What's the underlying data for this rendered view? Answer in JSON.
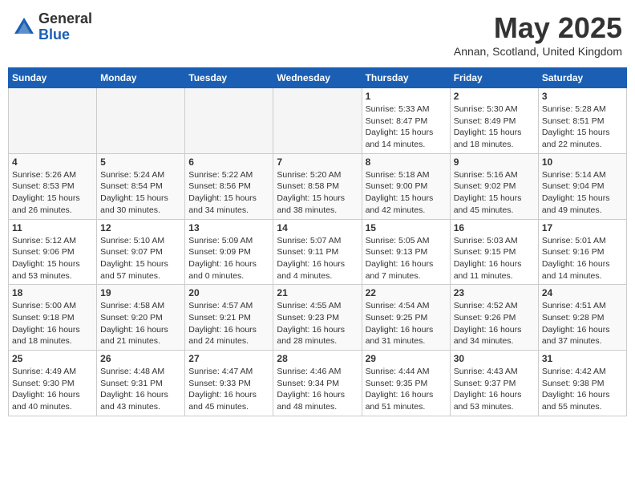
{
  "header": {
    "logo_general": "General",
    "logo_blue": "Blue",
    "month_title": "May 2025",
    "location": "Annan, Scotland, United Kingdom"
  },
  "weekdays": [
    "Sunday",
    "Monday",
    "Tuesday",
    "Wednesday",
    "Thursday",
    "Friday",
    "Saturday"
  ],
  "weeks": [
    [
      {
        "day": "",
        "info": ""
      },
      {
        "day": "",
        "info": ""
      },
      {
        "day": "",
        "info": ""
      },
      {
        "day": "",
        "info": ""
      },
      {
        "day": "1",
        "info": "Sunrise: 5:33 AM\nSunset: 8:47 PM\nDaylight: 15 hours\nand 14 minutes."
      },
      {
        "day": "2",
        "info": "Sunrise: 5:30 AM\nSunset: 8:49 PM\nDaylight: 15 hours\nand 18 minutes."
      },
      {
        "day": "3",
        "info": "Sunrise: 5:28 AM\nSunset: 8:51 PM\nDaylight: 15 hours\nand 22 minutes."
      }
    ],
    [
      {
        "day": "4",
        "info": "Sunrise: 5:26 AM\nSunset: 8:53 PM\nDaylight: 15 hours\nand 26 minutes."
      },
      {
        "day": "5",
        "info": "Sunrise: 5:24 AM\nSunset: 8:54 PM\nDaylight: 15 hours\nand 30 minutes."
      },
      {
        "day": "6",
        "info": "Sunrise: 5:22 AM\nSunset: 8:56 PM\nDaylight: 15 hours\nand 34 minutes."
      },
      {
        "day": "7",
        "info": "Sunrise: 5:20 AM\nSunset: 8:58 PM\nDaylight: 15 hours\nand 38 minutes."
      },
      {
        "day": "8",
        "info": "Sunrise: 5:18 AM\nSunset: 9:00 PM\nDaylight: 15 hours\nand 42 minutes."
      },
      {
        "day": "9",
        "info": "Sunrise: 5:16 AM\nSunset: 9:02 PM\nDaylight: 15 hours\nand 45 minutes."
      },
      {
        "day": "10",
        "info": "Sunrise: 5:14 AM\nSunset: 9:04 PM\nDaylight: 15 hours\nand 49 minutes."
      }
    ],
    [
      {
        "day": "11",
        "info": "Sunrise: 5:12 AM\nSunset: 9:06 PM\nDaylight: 15 hours\nand 53 minutes."
      },
      {
        "day": "12",
        "info": "Sunrise: 5:10 AM\nSunset: 9:07 PM\nDaylight: 15 hours\nand 57 minutes."
      },
      {
        "day": "13",
        "info": "Sunrise: 5:09 AM\nSunset: 9:09 PM\nDaylight: 16 hours\nand 0 minutes."
      },
      {
        "day": "14",
        "info": "Sunrise: 5:07 AM\nSunset: 9:11 PM\nDaylight: 16 hours\nand 4 minutes."
      },
      {
        "day": "15",
        "info": "Sunrise: 5:05 AM\nSunset: 9:13 PM\nDaylight: 16 hours\nand 7 minutes."
      },
      {
        "day": "16",
        "info": "Sunrise: 5:03 AM\nSunset: 9:15 PM\nDaylight: 16 hours\nand 11 minutes."
      },
      {
        "day": "17",
        "info": "Sunrise: 5:01 AM\nSunset: 9:16 PM\nDaylight: 16 hours\nand 14 minutes."
      }
    ],
    [
      {
        "day": "18",
        "info": "Sunrise: 5:00 AM\nSunset: 9:18 PM\nDaylight: 16 hours\nand 18 minutes."
      },
      {
        "day": "19",
        "info": "Sunrise: 4:58 AM\nSunset: 9:20 PM\nDaylight: 16 hours\nand 21 minutes."
      },
      {
        "day": "20",
        "info": "Sunrise: 4:57 AM\nSunset: 9:21 PM\nDaylight: 16 hours\nand 24 minutes."
      },
      {
        "day": "21",
        "info": "Sunrise: 4:55 AM\nSunset: 9:23 PM\nDaylight: 16 hours\nand 28 minutes."
      },
      {
        "day": "22",
        "info": "Sunrise: 4:54 AM\nSunset: 9:25 PM\nDaylight: 16 hours\nand 31 minutes."
      },
      {
        "day": "23",
        "info": "Sunrise: 4:52 AM\nSunset: 9:26 PM\nDaylight: 16 hours\nand 34 minutes."
      },
      {
        "day": "24",
        "info": "Sunrise: 4:51 AM\nSunset: 9:28 PM\nDaylight: 16 hours\nand 37 minutes."
      }
    ],
    [
      {
        "day": "25",
        "info": "Sunrise: 4:49 AM\nSunset: 9:30 PM\nDaylight: 16 hours\nand 40 minutes."
      },
      {
        "day": "26",
        "info": "Sunrise: 4:48 AM\nSunset: 9:31 PM\nDaylight: 16 hours\nand 43 minutes."
      },
      {
        "day": "27",
        "info": "Sunrise: 4:47 AM\nSunset: 9:33 PM\nDaylight: 16 hours\nand 45 minutes."
      },
      {
        "day": "28",
        "info": "Sunrise: 4:46 AM\nSunset: 9:34 PM\nDaylight: 16 hours\nand 48 minutes."
      },
      {
        "day": "29",
        "info": "Sunrise: 4:44 AM\nSunset: 9:35 PM\nDaylight: 16 hours\nand 51 minutes."
      },
      {
        "day": "30",
        "info": "Sunrise: 4:43 AM\nSunset: 9:37 PM\nDaylight: 16 hours\nand 53 minutes."
      },
      {
        "day": "31",
        "info": "Sunrise: 4:42 AM\nSunset: 9:38 PM\nDaylight: 16 hours\nand 55 minutes."
      }
    ]
  ]
}
